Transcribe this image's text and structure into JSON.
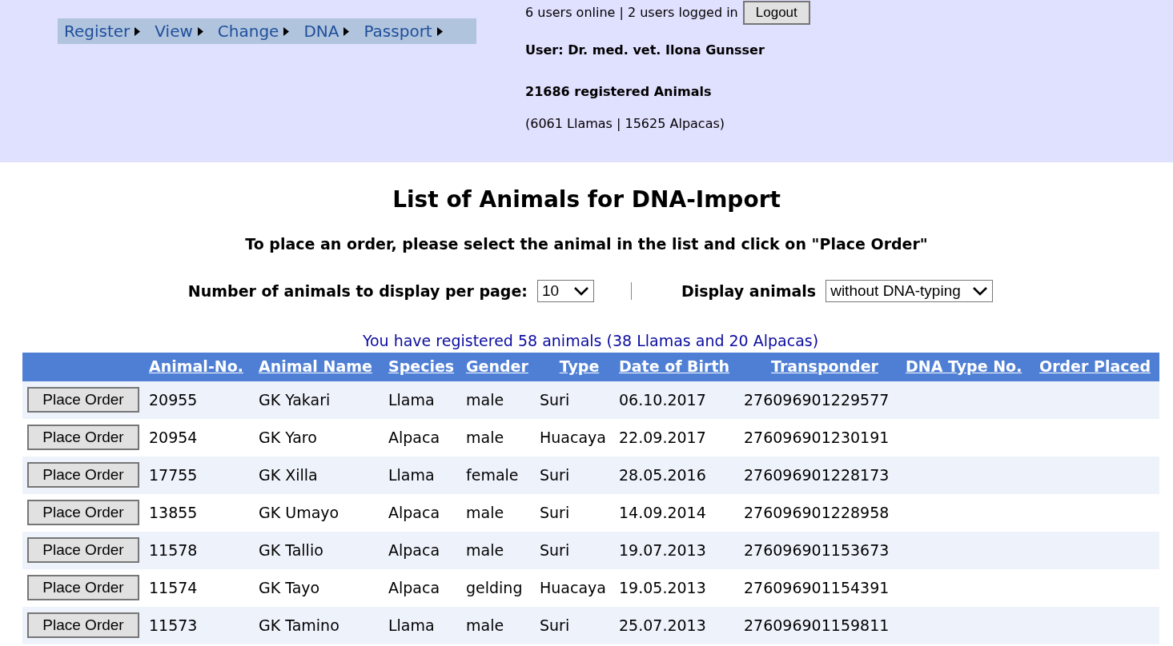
{
  "nav": {
    "items": [
      {
        "label": "Register"
      },
      {
        "label": "View"
      },
      {
        "label": "Change"
      },
      {
        "label": "DNA"
      },
      {
        "label": "Passport"
      }
    ]
  },
  "session": {
    "online": "6 users online | 2 users logged in",
    "logout": "Logout",
    "user": "User: Dr. med. vet. Ilona Gunsser",
    "registered": "21686 registered Animals",
    "breakdown": "(6061 Llamas | 15625 Alpacas)"
  },
  "page": {
    "title": "List of Animals for DNA-Import",
    "instruction": "To place an order, please select the animal in the list and click on \"Place Order\""
  },
  "controls": {
    "per_page_label": "Number of animals to display per page:",
    "per_page_value": "10",
    "display_label": "Display animals",
    "display_value": "without DNA-typing"
  },
  "summary": "You have registered 58 animals (38 Llamas and 20 Alpacas)",
  "table": {
    "columns": [
      "Animal-No.",
      "Animal Name",
      "Species",
      "Gender",
      "Type",
      "Date of Birth",
      "Transponder",
      "DNA Type No.",
      "Order Placed"
    ],
    "rows": [
      {
        "button": "Place Order",
        "cells": [
          "20955",
          "GK Yakari",
          "Llama",
          "male",
          "Suri",
          "06.10.2017",
          "276096901229577"
        ]
      },
      {
        "button": "Place Order",
        "cells": [
          "20954",
          "GK Yaro",
          "Alpaca",
          "male",
          "Huacaya",
          "22.09.2017",
          "276096901230191"
        ]
      },
      {
        "button": "Place Order",
        "cells": [
          "17755",
          "GK Xilla",
          "Llama",
          "female",
          "Suri",
          "28.05.2016",
          "276096901228173"
        ]
      },
      {
        "button": "Place Order",
        "cells": [
          "13855",
          "GK Umayo",
          "Alpaca",
          "male",
          "Suri",
          "14.09.2014",
          "276096901228958"
        ]
      },
      {
        "button": "Place Order",
        "cells": [
          "11578",
          "GK Tallio",
          "Alpaca",
          "male",
          "Suri",
          "19.07.2013",
          "276096901153673"
        ]
      },
      {
        "button": "Place Order",
        "cells": [
          "11574",
          "GK Tayo",
          "Alpaca",
          "gelding",
          "Huacaya",
          "19.05.2013",
          "276096901154391"
        ]
      },
      {
        "button": "Place Order",
        "cells": [
          "11573",
          "GK Tamino",
          "Llama",
          "male",
          "Suri",
          "25.07.2013",
          "276096901159811"
        ]
      }
    ]
  }
}
